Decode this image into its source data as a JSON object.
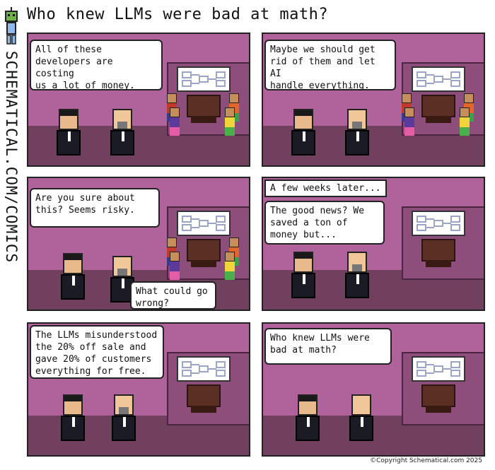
{
  "title": "Who knew LLMs were bad at math?",
  "sidebar": {
    "text": "SCHEMATICAL.COM/COMICS"
  },
  "panels": [
    {
      "speech": "All of these\ndevelopers are costing\nus a lot of money."
    },
    {
      "speech": "Maybe we should get\nrid of them and let AI\nhandle everything."
    },
    {
      "speech": "Are you sure about\nthis? Seems risky.",
      "reply": "What could go\nwrong?"
    },
    {
      "caption": "A few weeks later...",
      "speech": "The good news? We\nsaved a ton of\nmoney but..."
    },
    {
      "speech": "The LLMs misunderstood\nthe 20% off sale and\ngave 20% of customers\neverything for free."
    },
    {
      "speech": "Who knew LLMs were\nbad at math?"
    }
  ],
  "copyright": "©Copyright Schematical.com 2025",
  "colors": {
    "wall": "#b0629a",
    "floor": "#71405f",
    "desk": "#5c2f24"
  }
}
